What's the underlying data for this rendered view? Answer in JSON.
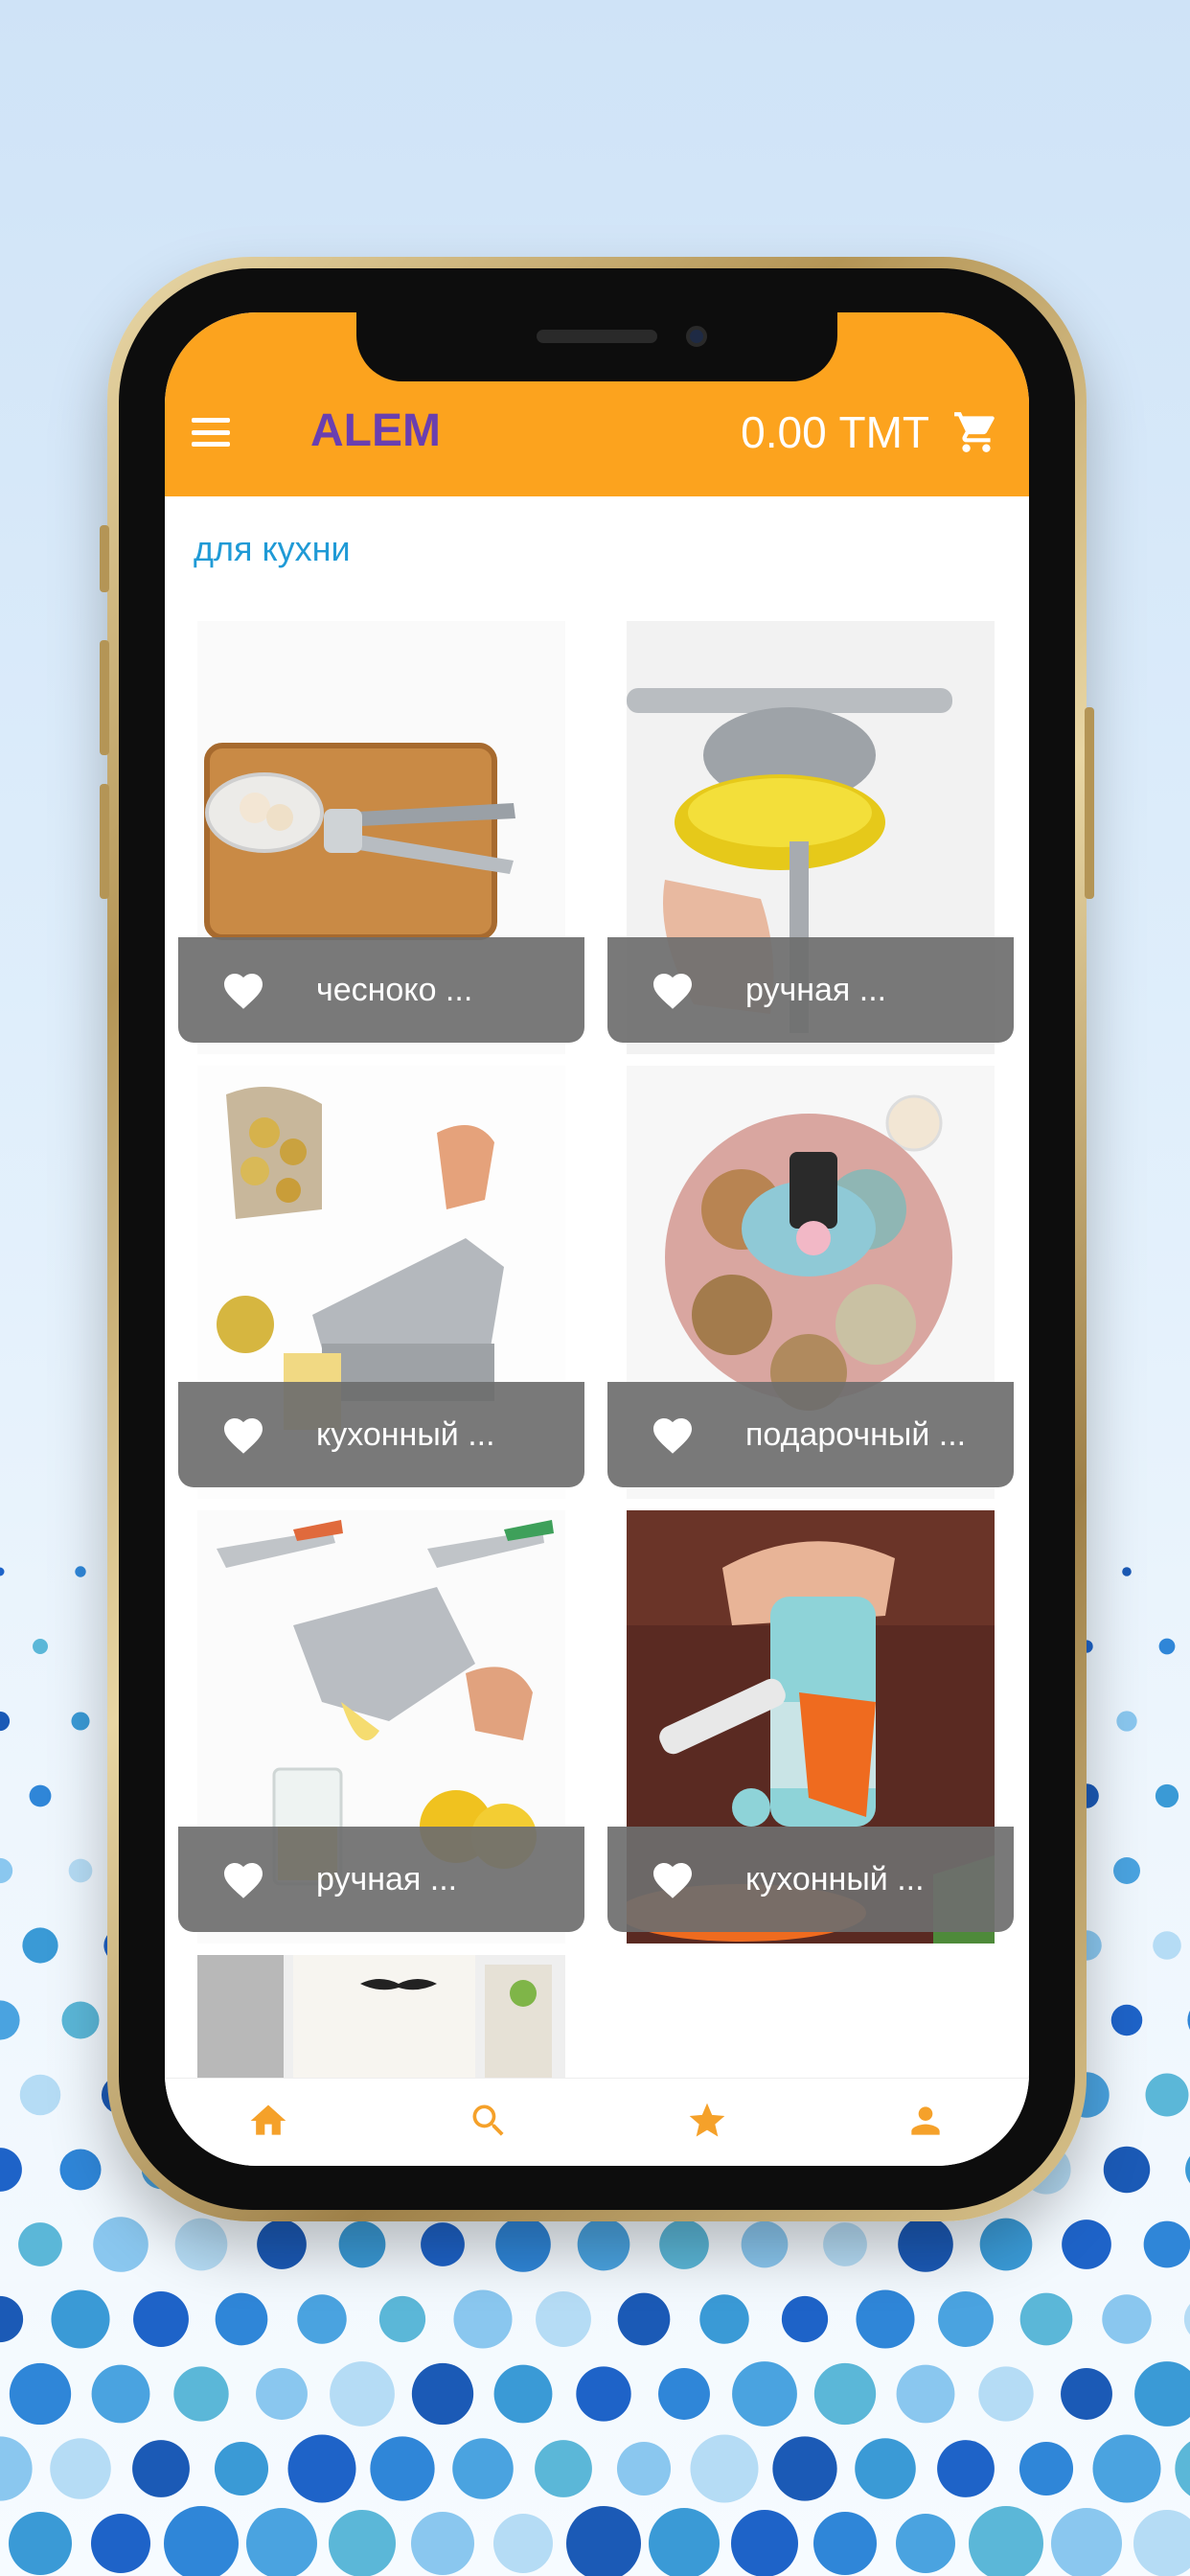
{
  "app": {
    "brand": "ALEM",
    "cart_total": "0.00 ТМТ",
    "category_title": "для кухни"
  },
  "colors": {
    "appbar": "#fca31e",
    "brand": "#6a3fb0",
    "category": "#1f9ad6",
    "nav_icons": "#f5a12a"
  },
  "products": [
    {
      "title": "чесноко ...",
      "image": "garlic-press"
    },
    {
      "title": "ручная ...",
      "image": "lemon-squeezer"
    },
    {
      "title": "кухонный ...",
      "image": "potato-cutter"
    },
    {
      "title": "подарочный ...",
      "image": "snack-tray"
    },
    {
      "title": "ручная ...",
      "image": "juice-press"
    },
    {
      "title": "кухонный ...",
      "image": "rotary-grater"
    }
  ],
  "bottom_nav": [
    {
      "icon": "home-icon"
    },
    {
      "icon": "search-icon"
    },
    {
      "icon": "star-icon"
    },
    {
      "icon": "person-icon"
    }
  ]
}
